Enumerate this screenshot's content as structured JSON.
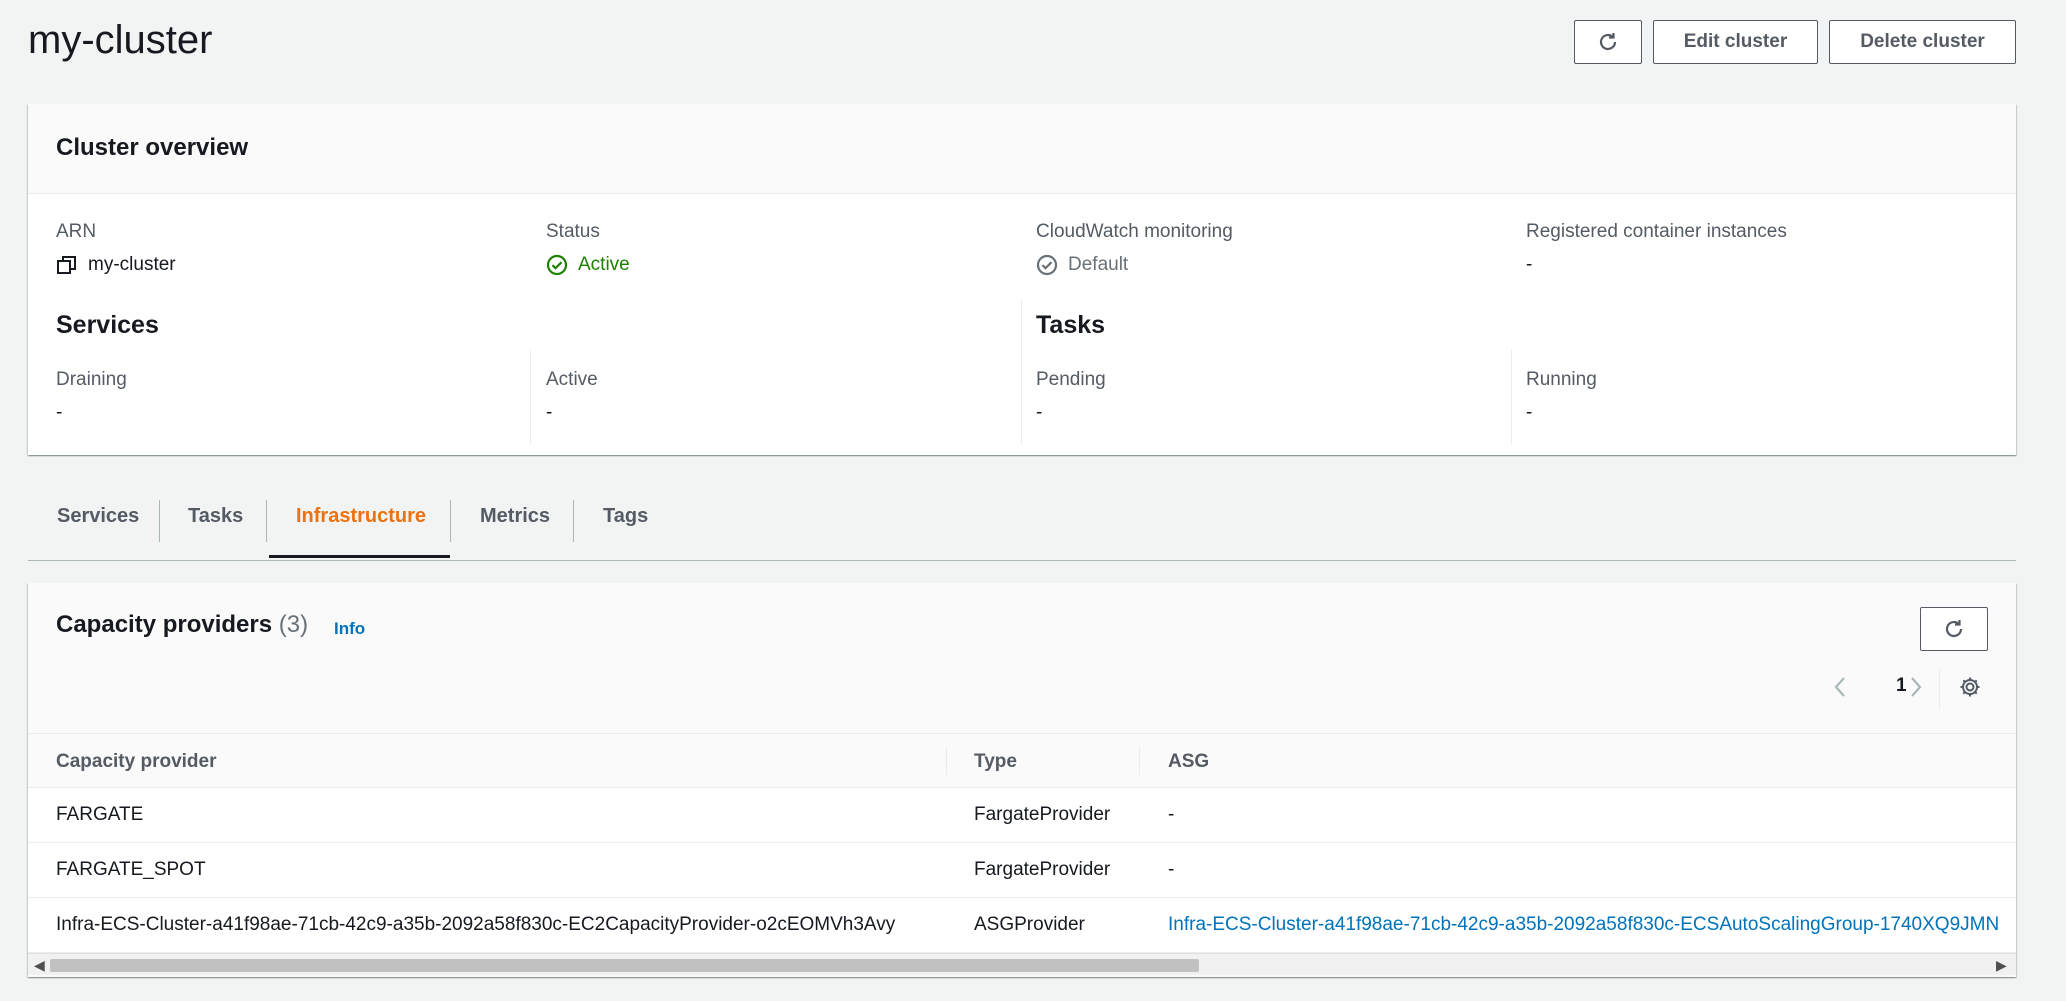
{
  "header": {
    "title": "my-cluster",
    "edit_label": "Edit cluster",
    "delete_label": "Delete cluster"
  },
  "overview": {
    "title": "Cluster overview",
    "arn_label": "ARN",
    "arn_value": "my-cluster",
    "status_label": "Status",
    "status_value": "Active",
    "cloudwatch_label": "CloudWatch monitoring",
    "cloudwatch_value": "Default",
    "registered_label": "Registered container instances",
    "registered_value": "-",
    "services_title": "Services",
    "draining_label": "Draining",
    "draining_value": "-",
    "active_label": "Active",
    "active_value": "-",
    "tasks_title": "Tasks",
    "pending_label": "Pending",
    "pending_value": "-",
    "running_label": "Running",
    "running_value": "-"
  },
  "tabs": [
    {
      "label": "Services",
      "active": false
    },
    {
      "label": "Tasks",
      "active": false
    },
    {
      "label": "Infrastructure",
      "active": true
    },
    {
      "label": "Metrics",
      "active": false
    },
    {
      "label": "Tags",
      "active": false
    }
  ],
  "capacity_providers": {
    "title": "Capacity providers",
    "count": "(3)",
    "info_label": "Info",
    "page": "1",
    "columns": [
      "Capacity provider",
      "Type",
      "ASG"
    ],
    "rows": [
      {
        "provider": "FARGATE",
        "type": "FargateProvider",
        "asg": "-"
      },
      {
        "provider": "FARGATE_SPOT",
        "type": "FargateProvider",
        "asg": "-"
      },
      {
        "provider": "Infra-ECS-Cluster-a41f98ae-71cb-42c9-a35b-2092a58f830c-EC2CapacityProvider-o2cEOMVh3Avy",
        "type": "ASGProvider",
        "asg": "Infra-ECS-Cluster-a41f98ae-71cb-42c9-a35b-2092a58f830c-ECSAutoScalingGroup-1740XQ9JMN"
      }
    ]
  },
  "colors": {
    "accent_tab": "#ec7211",
    "link": "#0073bb",
    "status_active": "#1d8102"
  }
}
